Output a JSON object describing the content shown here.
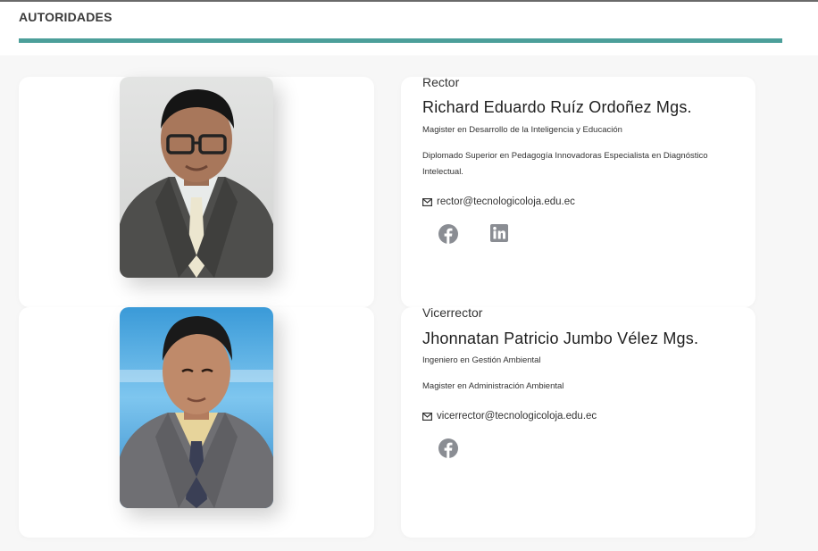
{
  "section": {
    "title": "AUTORIDADES"
  },
  "colors": {
    "accent": "#4c9f9a",
    "icon_gray": "#8a8d93"
  },
  "authorities": [
    {
      "role": "Rector",
      "name": "Richard Eduardo Ruíz Ordoñez Mgs.",
      "qualifications": [
        "Magister en Desarrollo de la Inteligencia y Educación",
        "Diplomado Superior en Pedagogía Innovadoras Especialista en Diagnóstico Intelectual."
      ],
      "email": "rector@tecnologicoloja.edu.ec",
      "social": [
        "facebook-icon",
        "linkedin-icon"
      ]
    },
    {
      "role": "Vicerrector",
      "name": "Jhonnatan Patricio Jumbo Vélez Mgs.",
      "qualifications": [
        "Ingeniero en Gestión Ambiental",
        "Magister en Administración Ambiental"
      ],
      "email": "vicerrector@tecnologicoloja.edu.ec",
      "social": [
        "facebook-icon"
      ]
    }
  ]
}
